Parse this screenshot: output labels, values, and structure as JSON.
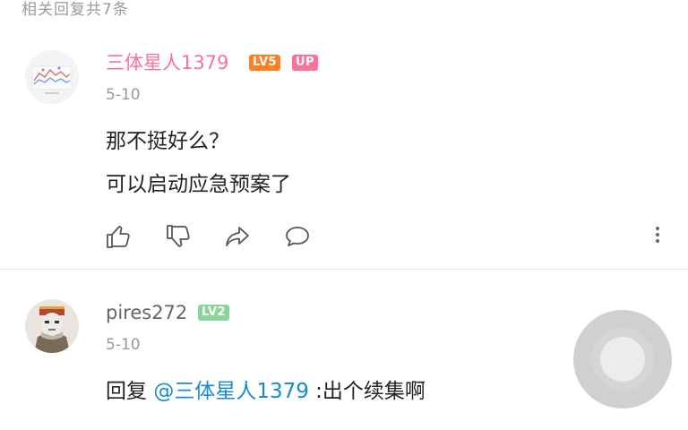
{
  "header": {
    "reply_count": "相关回复共7条"
  },
  "comments": [
    {
      "username": "三体星人1379",
      "level_badge": "LV5",
      "up_badge": "UP",
      "date": "5-10",
      "lines": [
        "那不挺好么？",
        "可以启动应急预案了"
      ],
      "name_color": "#fb7299"
    },
    {
      "username": "pires272",
      "level_badge": "LV2",
      "date": "5-10",
      "reply_prefix": "回复",
      "mention": "@三体星人1379",
      "reply_text": ":出个续集啊",
      "name_color": "#666666"
    }
  ],
  "icons": {
    "like": "thumbs-up-icon",
    "dislike": "thumbs-down-icon",
    "share": "share-icon",
    "reply": "comment-icon",
    "more": "more-vertical-icon"
  },
  "colors": {
    "mention": "#178bcf",
    "level5": "#ff7f24",
    "up": "#fb7299",
    "level2": "#8bd29b"
  }
}
